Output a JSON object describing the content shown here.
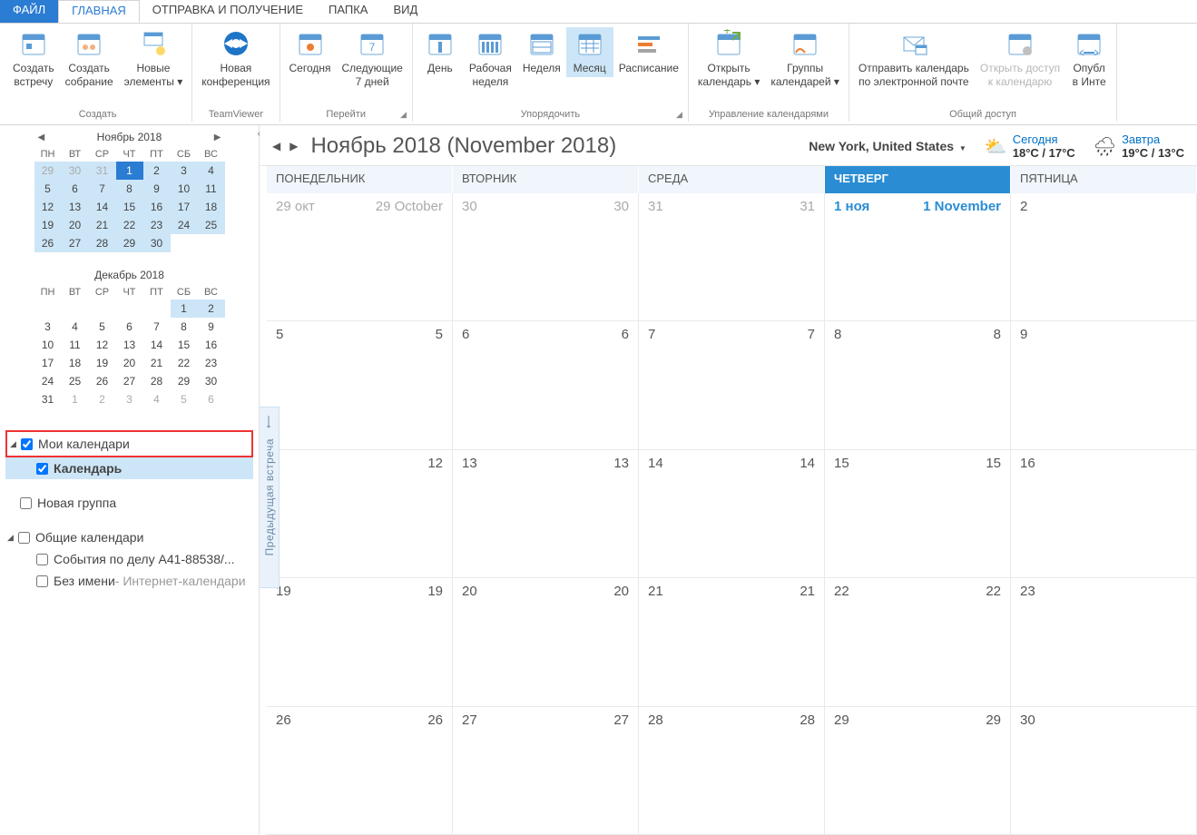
{
  "menu": {
    "file": "ФАЙЛ",
    "tabs": [
      "ГЛАВНАЯ",
      "ОТПРАВКА И ПОЛУЧЕНИЕ",
      "ПАПКА",
      "ВИД"
    ],
    "active_index": 0
  },
  "ribbon": {
    "groups": [
      {
        "label": "Создать",
        "launcher": false,
        "buttons": [
          {
            "key": "new-appointment",
            "label_lines": [
              "Создать",
              "встречу"
            ],
            "icon": "cal-one"
          },
          {
            "key": "new-meeting",
            "label_lines": [
              "Создать",
              "собрание"
            ],
            "icon": "people-cal"
          },
          {
            "key": "new-items",
            "label_lines": [
              "Новые",
              "элементы ▾"
            ],
            "icon": "items"
          }
        ]
      },
      {
        "label": "TeamViewer",
        "launcher": false,
        "buttons": [
          {
            "key": "new-conference",
            "label_lines": [
              "Новая",
              "конференция"
            ],
            "icon": "teamviewer"
          }
        ]
      },
      {
        "label": "Перейти",
        "launcher": true,
        "buttons": [
          {
            "key": "today",
            "label_lines": [
              "Сегодня"
            ],
            "icon": "cal-today"
          },
          {
            "key": "next7",
            "label_lines": [
              "Следующие",
              "7 дней"
            ],
            "icon": "cal-7"
          }
        ]
      },
      {
        "label": "Упорядочить",
        "launcher": true,
        "buttons": [
          {
            "key": "day",
            "label_lines": [
              "День"
            ],
            "icon": "cal-day"
          },
          {
            "key": "workweek",
            "label_lines": [
              "Рабочая",
              "неделя"
            ],
            "icon": "cal-workweek"
          },
          {
            "key": "week",
            "label_lines": [
              "Неделя"
            ],
            "icon": "cal-week"
          },
          {
            "key": "month",
            "label_lines": [
              "Месяц"
            ],
            "icon": "cal-month",
            "active": true
          },
          {
            "key": "schedule",
            "label_lines": [
              "Расписание"
            ],
            "icon": "cal-schedule"
          }
        ]
      },
      {
        "label": "Управление календарями",
        "launcher": false,
        "buttons": [
          {
            "key": "open-calendar",
            "label_lines": [
              "Открыть",
              "календарь ▾"
            ],
            "icon": "open-cal"
          },
          {
            "key": "calendar-groups",
            "label_lines": [
              "Группы",
              "календарей ▾"
            ],
            "icon": "cal-groups"
          }
        ]
      },
      {
        "label": "Общий доступ",
        "launcher": false,
        "buttons": [
          {
            "key": "email-calendar",
            "label_lines": [
              "Отправить календарь",
              "по электронной почте"
            ],
            "icon": "email-cal"
          },
          {
            "key": "share-calendar",
            "label_lines": [
              "Открыть доступ",
              "к календарю"
            ],
            "icon": "share-cal",
            "disabled": true
          },
          {
            "key": "publish",
            "label_lines": [
              "Опубл",
              "в Инте"
            ],
            "icon": "publish"
          }
        ]
      }
    ]
  },
  "sidebar": {
    "mini_cals": [
      {
        "title": "Ноябрь 2018",
        "show_nav": true,
        "dow": [
          "ПН",
          "ВТ",
          "СР",
          "ЧТ",
          "ПТ",
          "СБ",
          "ВС"
        ],
        "rows": [
          [
            {
              "n": "29",
              "dim": true,
              "hl": true
            },
            {
              "n": "30",
              "dim": true,
              "hl": true
            },
            {
              "n": "31",
              "dim": true,
              "hl": true
            },
            {
              "n": "1",
              "today": true
            },
            {
              "n": "2",
              "hl": true
            },
            {
              "n": "3",
              "hl": true
            },
            {
              "n": "4",
              "hl": true
            }
          ],
          [
            {
              "n": "5",
              "hl": true
            },
            {
              "n": "6",
              "hl": true
            },
            {
              "n": "7",
              "hl": true
            },
            {
              "n": "8",
              "hl": true
            },
            {
              "n": "9",
              "hl": true
            },
            {
              "n": "10",
              "hl": true
            },
            {
              "n": "11",
              "hl": true
            }
          ],
          [
            {
              "n": "12",
              "hl": true
            },
            {
              "n": "13",
              "hl": true
            },
            {
              "n": "14",
              "hl": true
            },
            {
              "n": "15",
              "hl": true
            },
            {
              "n": "16",
              "hl": true
            },
            {
              "n": "17",
              "hl": true
            },
            {
              "n": "18",
              "hl": true
            }
          ],
          [
            {
              "n": "19",
              "hl": true
            },
            {
              "n": "20",
              "hl": true
            },
            {
              "n": "21",
              "hl": true
            },
            {
              "n": "22",
              "hl": true
            },
            {
              "n": "23",
              "hl": true
            },
            {
              "n": "24",
              "hl": true
            },
            {
              "n": "25",
              "hl": true
            }
          ],
          [
            {
              "n": "26",
              "hl": true
            },
            {
              "n": "27",
              "hl": true
            },
            {
              "n": "28",
              "hl": true
            },
            {
              "n": "29",
              "hl": true
            },
            {
              "n": "30",
              "hl": true
            },
            {
              "n": "",
              "dim": true
            },
            {
              "n": "",
              "dim": true
            }
          ]
        ]
      },
      {
        "title": "Декабрь 2018",
        "show_nav": false,
        "dow": [
          "ПН",
          "ВТ",
          "СР",
          "ЧТ",
          "ПТ",
          "СБ",
          "ВС"
        ],
        "rows": [
          [
            {
              "n": ""
            },
            {
              "n": ""
            },
            {
              "n": ""
            },
            {
              "n": ""
            },
            {
              "n": ""
            },
            {
              "n": "1",
              "hl": true
            },
            {
              "n": "2",
              "hl": true
            }
          ],
          [
            {
              "n": "3"
            },
            {
              "n": "4"
            },
            {
              "n": "5"
            },
            {
              "n": "6"
            },
            {
              "n": "7"
            },
            {
              "n": "8"
            },
            {
              "n": "9"
            }
          ],
          [
            {
              "n": "10"
            },
            {
              "n": "11"
            },
            {
              "n": "12"
            },
            {
              "n": "13"
            },
            {
              "n": "14"
            },
            {
              "n": "15"
            },
            {
              "n": "16"
            }
          ],
          [
            {
              "n": "17"
            },
            {
              "n": "18"
            },
            {
              "n": "19"
            },
            {
              "n": "20"
            },
            {
              "n": "21"
            },
            {
              "n": "22"
            },
            {
              "n": "23"
            }
          ],
          [
            {
              "n": "24"
            },
            {
              "n": "25"
            },
            {
              "n": "26"
            },
            {
              "n": "27"
            },
            {
              "n": "28"
            },
            {
              "n": "29"
            },
            {
              "n": "30"
            }
          ],
          [
            {
              "n": "31"
            },
            {
              "n": "1",
              "dim": true
            },
            {
              "n": "2",
              "dim": true
            },
            {
              "n": "3",
              "dim": true
            },
            {
              "n": "4",
              "dim": true
            },
            {
              "n": "5",
              "dim": true
            },
            {
              "n": "6",
              "dim": true
            }
          ]
        ]
      }
    ],
    "tree": {
      "my_calendars": {
        "label": "Мои календари",
        "checked": true
      },
      "calendar": {
        "label": "Календарь",
        "checked": true
      },
      "new_group": {
        "label": "Новая группа",
        "checked": false
      },
      "shared": {
        "label": "Общие календари",
        "checked": false
      },
      "case_events": {
        "label": "События по делу А41-88538/...",
        "checked": false
      },
      "unnamed": {
        "label": "Без имени",
        "suffix": " - Интернет-календари",
        "checked": false
      }
    }
  },
  "content": {
    "title": "Ноябрь 2018 (November 2018)",
    "prev_meeting_tab": "Предыдущая встреча",
    "weather": {
      "location": "New York, United States",
      "today_label": "Сегодня",
      "today_temp": "18°C / 17°C",
      "tomorrow_label": "Завтра",
      "tomorrow_temp": "19°C / 13°C"
    },
    "dow": [
      {
        "label": "ПОНЕДЕЛЬНИК"
      },
      {
        "label": "ВТОРНИК"
      },
      {
        "label": "СРЕДА"
      },
      {
        "label": "ЧЕТВЕРГ",
        "today": true
      },
      {
        "label": "ПЯТНИЦА"
      }
    ],
    "weeks": [
      [
        {
          "l": "29 окт",
          "r": "29 October",
          "dim": true
        },
        {
          "l": "30",
          "r": "30",
          "dim": true
        },
        {
          "l": "31",
          "r": "31",
          "dim": true
        },
        {
          "l": "1 ноя",
          "r": "1 November",
          "today": true
        },
        {
          "l": "2",
          "r": ""
        }
      ],
      [
        {
          "l": "5",
          "r": "5"
        },
        {
          "l": "6",
          "r": "6"
        },
        {
          "l": "7",
          "r": "7"
        },
        {
          "l": "8",
          "r": "8"
        },
        {
          "l": "9",
          "r": ""
        }
      ],
      [
        {
          "l": "",
          "r": "12"
        },
        {
          "l": "13",
          "r": "13"
        },
        {
          "l": "14",
          "r": "14"
        },
        {
          "l": "15",
          "r": "15"
        },
        {
          "l": "16",
          "r": ""
        }
      ],
      [
        {
          "l": "19",
          "r": "19"
        },
        {
          "l": "20",
          "r": "20"
        },
        {
          "l": "21",
          "r": "21"
        },
        {
          "l": "22",
          "r": "22"
        },
        {
          "l": "23",
          "r": ""
        }
      ],
      [
        {
          "l": "26",
          "r": "26"
        },
        {
          "l": "27",
          "r": "27"
        },
        {
          "l": "28",
          "r": "28"
        },
        {
          "l": "29",
          "r": "29"
        },
        {
          "l": "30",
          "r": ""
        }
      ]
    ]
  }
}
